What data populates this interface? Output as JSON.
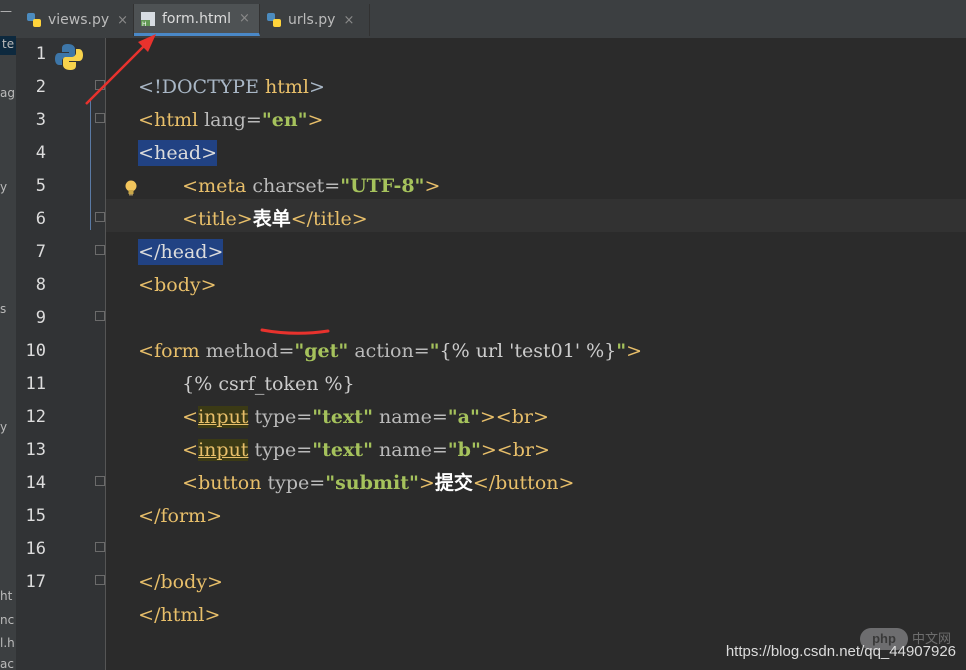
{
  "sidebar": {
    "fragments": [
      "—",
      "te",
      "ag",
      "y",
      "s",
      "y",
      "ht",
      "nc",
      "l.h",
      "ac"
    ]
  },
  "tabs": [
    {
      "label": "views.py",
      "icon": "python-file-icon",
      "active": false
    },
    {
      "label": "form.html",
      "icon": "html-file-icon",
      "active": true
    },
    {
      "label": "urls.py",
      "icon": "python-file-icon",
      "active": false
    }
  ],
  "tab_close_glyph": "×",
  "editor": {
    "line_numbers": [
      "1",
      "2",
      "3",
      "4",
      "5",
      "6",
      "7",
      "8",
      "9",
      "10",
      "11",
      "12",
      "13",
      "14",
      "15",
      "16",
      "17"
    ],
    "lines": {
      "l1": {
        "a": "<!DOCTYPE ",
        "b": "html",
        "c": ">"
      },
      "l2": {
        "a": "<html ",
        "b": "lang=",
        "c": "\"en\"",
        "d": ">"
      },
      "l3": {
        "a": "<head>"
      },
      "l4": {
        "a": "<meta ",
        "b": "charset=",
        "c": "\"UTF-8\"",
        "d": ">"
      },
      "l5": {
        "a": "<title>",
        "b": "表单",
        "c": "</title>"
      },
      "l6": {
        "a": "</head>"
      },
      "l7": {
        "a": "<body>"
      },
      "l9": {
        "a": "<form ",
        "b": "method=",
        "c": "\"get\"",
        "d": " action=",
        "e": "\"",
        "f": "{% url 'test01' %}",
        "g": "\"",
        "h": ">"
      },
      "l10": {
        "a": "{% csrf_token %}"
      },
      "l11": {
        "a": "<",
        "b": "input",
        "c": " type=",
        "d": "\"text\"",
        "e": " name=",
        "f": "\"a\"",
        "g": "><br>"
      },
      "l12": {
        "a": "<",
        "b": "input",
        "c": " type=",
        "d": "\"text\"",
        "e": " name=",
        "f": "\"b\"",
        "g": "><br>"
      },
      "l13": {
        "a": "<button ",
        "b": "type=",
        "c": "\"submit\"",
        "d": ">",
        "e": "提交",
        "f": "</button>"
      },
      "l14": {
        "a": "</form>"
      },
      "l16": {
        "a": "</body>"
      },
      "l17": {
        "a": "</html>"
      }
    }
  },
  "watermark": "https://blog.csdn.net/qq_44907926",
  "php_logo": "php",
  "php_cn": "中文网",
  "colors": {
    "background": "#2b2b2b",
    "tag": "#e8bf6a",
    "string": "#a5c25c",
    "selection": "#214283",
    "annotation": "#e8322d"
  }
}
